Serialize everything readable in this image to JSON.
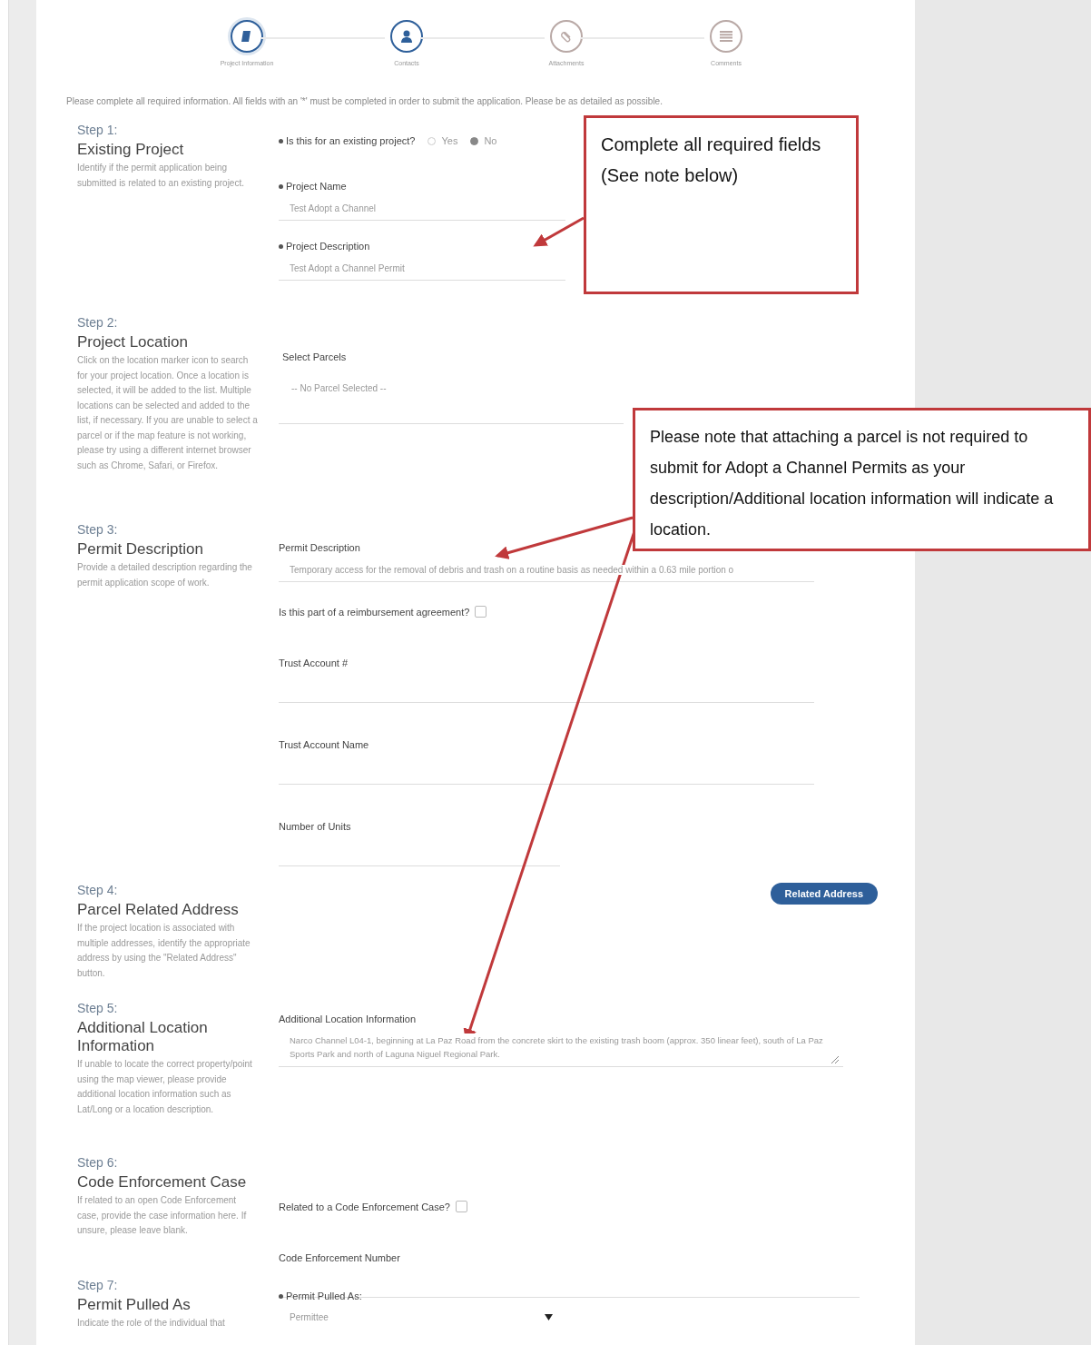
{
  "progress_steps": [
    {
      "label": "Project Information",
      "kind": "document",
      "selected": true,
      "enabled": true
    },
    {
      "label": "Contacts",
      "kind": "person",
      "selected": false,
      "enabled": true
    },
    {
      "label": "Attachments",
      "kind": "paperclip",
      "selected": false,
      "enabled": false
    },
    {
      "label": "Comments",
      "kind": "list",
      "selected": false,
      "enabled": false
    }
  ],
  "intro": "Please complete all required information. All fields with an '*' must be completed in order to submit the application. Please be as detailed as possible.",
  "sections": [
    {
      "step": "Step 1:",
      "title": "Existing Project",
      "description": "Identify if the permit application being submitted is related to an existing project.",
      "fields": [
        {
          "kind": "radio",
          "label": "Is this for an existing project?",
          "required": true,
          "options": [
            {
              "label": "Yes",
              "selected": false
            },
            {
              "label": "No",
              "selected": true
            }
          ]
        },
        {
          "kind": "text",
          "label": "Project Name",
          "required": true,
          "value": "Test Adopt a Channel"
        },
        {
          "kind": "text",
          "label": "Project Description",
          "required": true,
          "value": "Test Adopt a Channel Permit"
        }
      ]
    },
    {
      "step": "Step 2:",
      "title": "Project Location",
      "description": "Click on the location marker icon to search for your project location. Once a location is selected, it will be added to the list. Multiple locations can be selected and added to the list, if necessary. If you are unable to select a parcel or if the map feature is not working, please try using a different internet browser such as Chrome, Safari, or Firefox.",
      "fields": [
        {
          "kind": "list",
          "label": "Select Parcels",
          "value": "-- No Parcel Selected --"
        }
      ]
    },
    {
      "step": "Step 3:",
      "title": "Permit Description",
      "description": "Provide a detailed description regarding the permit application scope of work.",
      "fields": [
        {
          "kind": "text",
          "label": "Permit Description",
          "value": "Temporary access for the removal of debris and trash on a routine basis as needed within a 0.63 mile portion o"
        },
        {
          "kind": "checkbox",
          "label": "Is this part of a reimbursement agreement?",
          "checked": false
        },
        {
          "kind": "text",
          "label": "Trust Account #"
        },
        {
          "kind": "text",
          "label": "Trust Account Name"
        },
        {
          "kind": "number",
          "label": "Number of Units"
        }
      ]
    },
    {
      "step": "Step 4:",
      "title": "Parcel Related Address",
      "description": "If the project location is associated with multiple addresses, identify the appropriate address by using the \"Related Address\" button.",
      "fields": [
        {
          "kind": "button",
          "label": "Related Address"
        }
      ]
    },
    {
      "step": "Step 5:",
      "title": "Additional Location Information",
      "description": "If unable to locate the correct property/point using the map viewer, please provide additional location information such as Lat/Long or a location description.",
      "fields": [
        {
          "kind": "textarea",
          "label": "Additional Location Information",
          "value": "Narco Channel L04-1, beginning at La Paz Road from the concrete skirt to the existing trash boom (approx. 350 linear feet), south of La Paz Sports Park and north of Laguna Niguel Regional Park."
        }
      ]
    },
    {
      "step": "Step 6:",
      "title": "Code Enforcement Case",
      "description": "If related to an open Code Enforcement case, provide the case information here. If unsure, please leave blank.",
      "fields": [
        {
          "kind": "checkbox",
          "label": "Related to a Code Enforcement Case?",
          "checked": false
        },
        {
          "kind": "text",
          "label": "Code Enforcement Number"
        }
      ]
    },
    {
      "step": "Step 7:",
      "title": "Permit Pulled As",
      "description": "Indicate the role of the individual that",
      "fields": [
        {
          "kind": "select",
          "label": "Permit Pulled As:",
          "required": true,
          "value": "Permittee"
        }
      ]
    }
  ],
  "annotations": [
    {
      "text": "Complete all required fields (See note below)"
    },
    {
      "text": "Please note that attaching a parcel is not required to submit for Adopt a Channel Permits as your description/Additional location information will indicate a location."
    }
  ]
}
